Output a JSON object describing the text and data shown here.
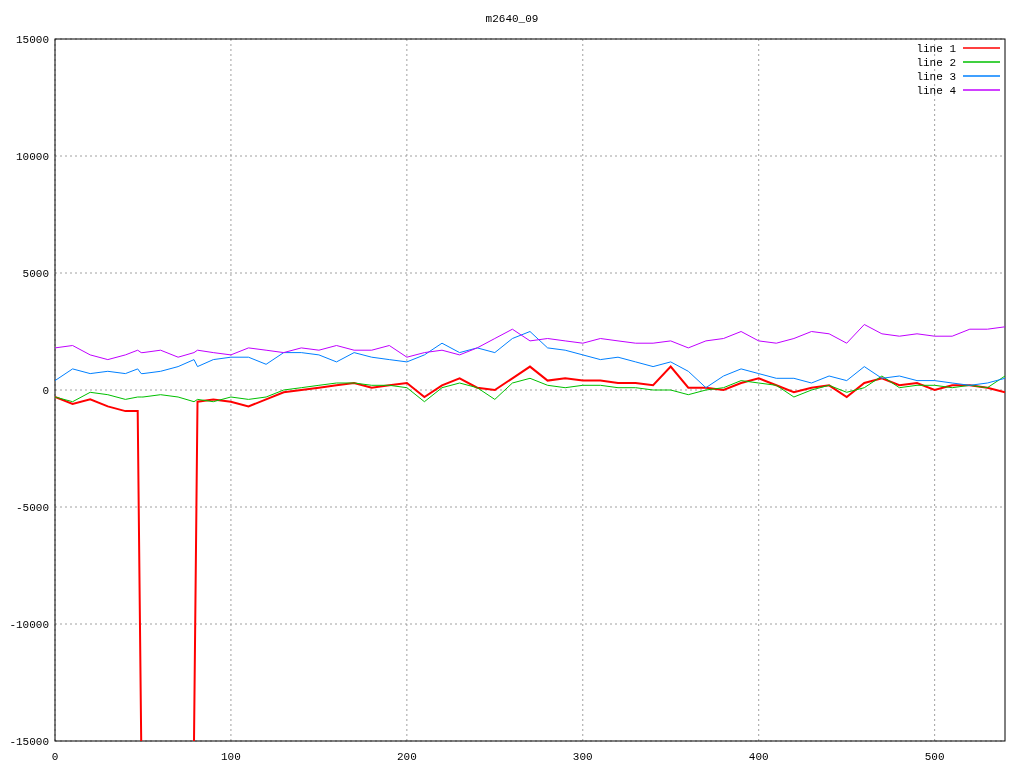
{
  "chart_data": {
    "type": "line",
    "title": "m2640_09",
    "x": [
      0,
      10,
      20,
      30,
      40,
      47,
      49,
      50,
      60,
      70,
      79,
      81,
      90,
      100,
      110,
      120,
      130,
      140,
      150,
      160,
      170,
      180,
      190,
      200,
      210,
      220,
      230,
      240,
      250,
      260,
      270,
      280,
      290,
      300,
      310,
      320,
      330,
      340,
      350,
      360,
      370,
      380,
      390,
      400,
      410,
      420,
      430,
      440,
      450,
      460,
      470,
      480,
      490,
      500,
      510,
      520,
      530,
      540
    ],
    "series": [
      {
        "name": "line 1",
        "color": "#ff0000",
        "values": [
          -300,
          -600,
          -400,
          -700,
          -900,
          -900,
          -15000,
          null,
          null,
          null,
          -15000,
          -500,
          -400,
          -500,
          -700,
          -400,
          -100,
          0,
          100,
          200,
          300,
          100,
          200,
          300,
          -300,
          200,
          500,
          100,
          0,
          500,
          1000,
          400,
          500,
          400,
          400,
          300,
          300,
          200,
          1000,
          100,
          100,
          0,
          300,
          500,
          200,
          -100,
          100,
          200,
          -300,
          300,
          500,
          200,
          300,
          0,
          200,
          200,
          100,
          -100
        ]
      },
      {
        "name": "line 2",
        "color": "#00c000",
        "values": [
          -300,
          -500,
          -100,
          -200,
          -400,
          -300,
          -300,
          -300,
          -200,
          -300,
          -500,
          -400,
          -500,
          -300,
          -400,
          -300,
          0,
          100,
          200,
          300,
          300,
          200,
          200,
          100,
          -500,
          100,
          300,
          100,
          -400,
          300,
          500,
          200,
          100,
          200,
          200,
          100,
          100,
          0,
          0,
          -200,
          0,
          100,
          400,
          300,
          200,
          -300,
          0,
          200,
          -100,
          100,
          600,
          100,
          200,
          200,
          100,
          200,
          100,
          600
        ]
      },
      {
        "name": "line 3",
        "color": "#0080ff",
        "values": [
          400,
          900,
          700,
          800,
          700,
          900,
          700,
          700,
          800,
          1000,
          1300,
          1000,
          1300,
          1400,
          1400,
          1100,
          1600,
          1600,
          1500,
          1200,
          1600,
          1400,
          1300,
          1200,
          1500,
          2000,
          1600,
          1800,
          1600,
          2200,
          2500,
          1800,
          1700,
          1500,
          1300,
          1400,
          1200,
          1000,
          1200,
          800,
          100,
          600,
          900,
          700,
          500,
          500,
          300,
          600,
          400,
          1000,
          500,
          600,
          400,
          400,
          300,
          200,
          300,
          500
        ]
      },
      {
        "name": "line 4",
        "color": "#c000ff",
        "values": [
          1800,
          1900,
          1500,
          1300,
          1500,
          1700,
          1600,
          1600,
          1700,
          1400,
          1600,
          1700,
          1600,
          1500,
          1800,
          1700,
          1600,
          1800,
          1700,
          1900,
          1700,
          1700,
          1900,
          1400,
          1600,
          1700,
          1500,
          1800,
          2200,
          2600,
          2100,
          2200,
          2100,
          2000,
          2200,
          2100,
          2000,
          2000,
          2100,
          1800,
          2100,
          2200,
          2500,
          2100,
          2000,
          2200,
          2500,
          2400,
          2000,
          2800,
          2400,
          2300,
          2400,
          2300,
          2300,
          2600,
          2600,
          2700
        ]
      }
    ],
    "grid": true,
    "legend": true,
    "xlim": [
      0,
      540
    ],
    "ylim": [
      -15000,
      15000
    ],
    "xticks": [
      0,
      100,
      200,
      300,
      400,
      500
    ],
    "yticks": [
      -15000,
      -10000,
      -5000,
      0,
      5000,
      10000,
      15000
    ]
  }
}
